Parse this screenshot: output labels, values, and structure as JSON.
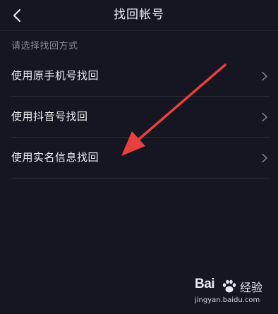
{
  "header": {
    "title": "找回帐号",
    "back_icon": "chevron-left-icon"
  },
  "section_label": "请选择找回方式",
  "options": [
    {
      "label": "使用原手机号找回",
      "icon": "chevron-right-icon"
    },
    {
      "label": "使用抖音号找回",
      "icon": "chevron-right-icon"
    },
    {
      "label": "使用实名信息找回",
      "icon": "chevron-right-icon"
    }
  ],
  "annotation": {
    "color": "#e8403c"
  },
  "watermark": {
    "brand": "Bai",
    "brand_cn": "经验",
    "url": "jingyan.baidu.com"
  },
  "colors": {
    "background": "#161622",
    "divider": "#2a2a36",
    "secondary_text": "#8a8a96"
  }
}
